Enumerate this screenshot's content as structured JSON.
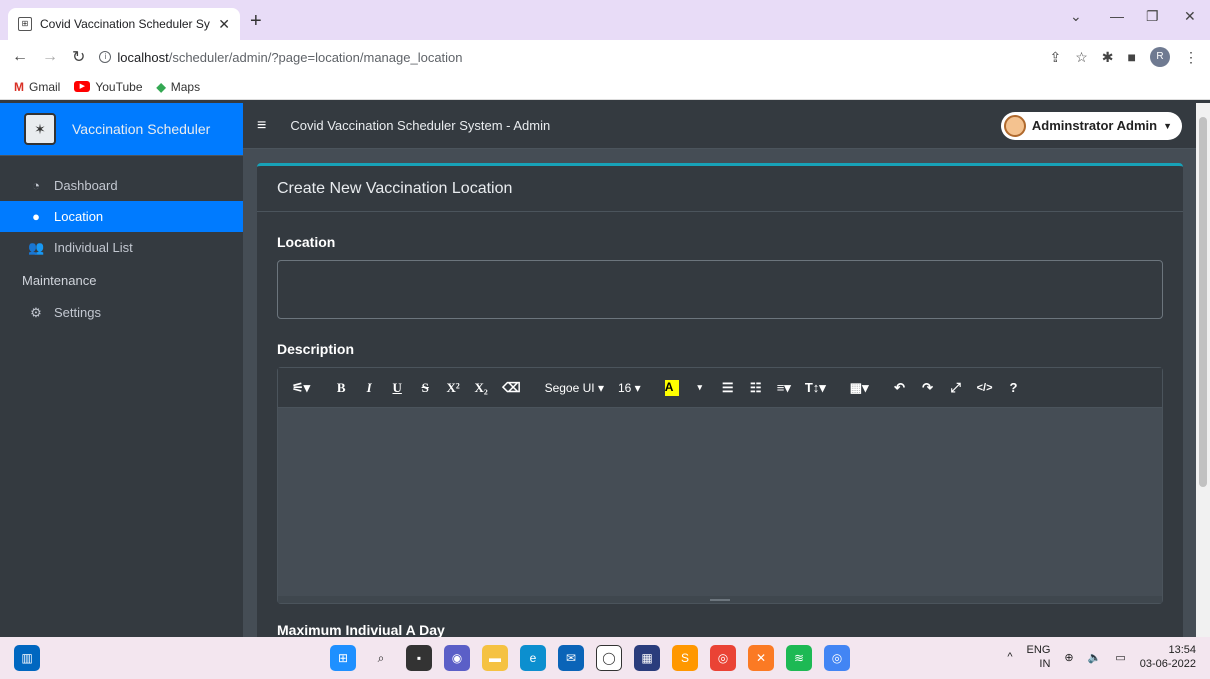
{
  "browser": {
    "tab_title": "Covid Vaccination Scheduler Syst",
    "url_host": "localhost",
    "url_path": "/scheduler/admin/?page=location/manage_location",
    "bookmarks": [
      "Gmail",
      "YouTube",
      "Maps"
    ],
    "profile_initial": "R"
  },
  "sidebar": {
    "brand": "Vaccination Scheduler",
    "items": [
      {
        "label": "Dashboard",
        "icon": "tachometer-icon"
      },
      {
        "label": "Location",
        "icon": "map-marker-icon",
        "active": true
      },
      {
        "label": "Individual List",
        "icon": "users-icon"
      }
    ],
    "section_header": "Maintenance",
    "maintenance_items": [
      {
        "label": "Settings",
        "icon": "cogs-icon"
      }
    ]
  },
  "header": {
    "title": "Covid Vaccination Scheduler System - Admin",
    "user": "Adminstrator Admin"
  },
  "card": {
    "title": "Create New Vaccination Location",
    "location_label": "Location",
    "location_value": "",
    "description_label": "Description",
    "next_label": "Maximum Indiviual A Day"
  },
  "editor": {
    "font": "Segoe UI",
    "size": "16"
  },
  "taskbar": {
    "lang": "ENG",
    "region": "IN",
    "time": "13:54",
    "date": "03-06-2022"
  },
  "colors": {
    "primary": "#007bff",
    "card_accent": "#17a2b8",
    "dark": "#343a40"
  }
}
